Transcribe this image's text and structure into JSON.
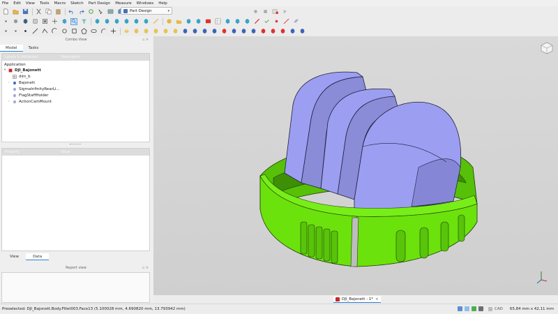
{
  "menu": [
    "File",
    "Edit",
    "View",
    "Tools",
    "Macro",
    "Sketch",
    "Part Design",
    "Measure",
    "Windows",
    "Help"
  ],
  "workbench": {
    "selected": "Part Design"
  },
  "combo_view": {
    "title": "Combo View",
    "tabs": [
      "Model",
      "Tasks"
    ],
    "tree_headers": [
      "Labels & Attributes",
      "Description"
    ],
    "group_label": "Application",
    "document": "DJI_Bajonett",
    "items": [
      "dim_b",
      "Bajonett",
      "SigmaInfinityRearLi...",
      "FlagStaffHolder",
      "ActionCamMount"
    ],
    "property_headers": [
      "Property",
      "Value"
    ],
    "bottom_tabs": [
      "View",
      "Data"
    ]
  },
  "report_view": {
    "title": "Report view"
  },
  "doc_tab": {
    "label": "DJI_Bajonett : 1*"
  },
  "status": {
    "text": "Preselected: DJI_Bajonett.Body.Fillet003.Face13 (5.100028 mm, 4.690820 mm, 13.793942 mm)",
    "nav_style": "CAD",
    "dimensions": "65,84 mm x 42,11 mm"
  },
  "colors": {
    "cradle_body": "#9c9ef2",
    "ring_body": "#6ce20c",
    "accent": "#2a7fd4"
  }
}
